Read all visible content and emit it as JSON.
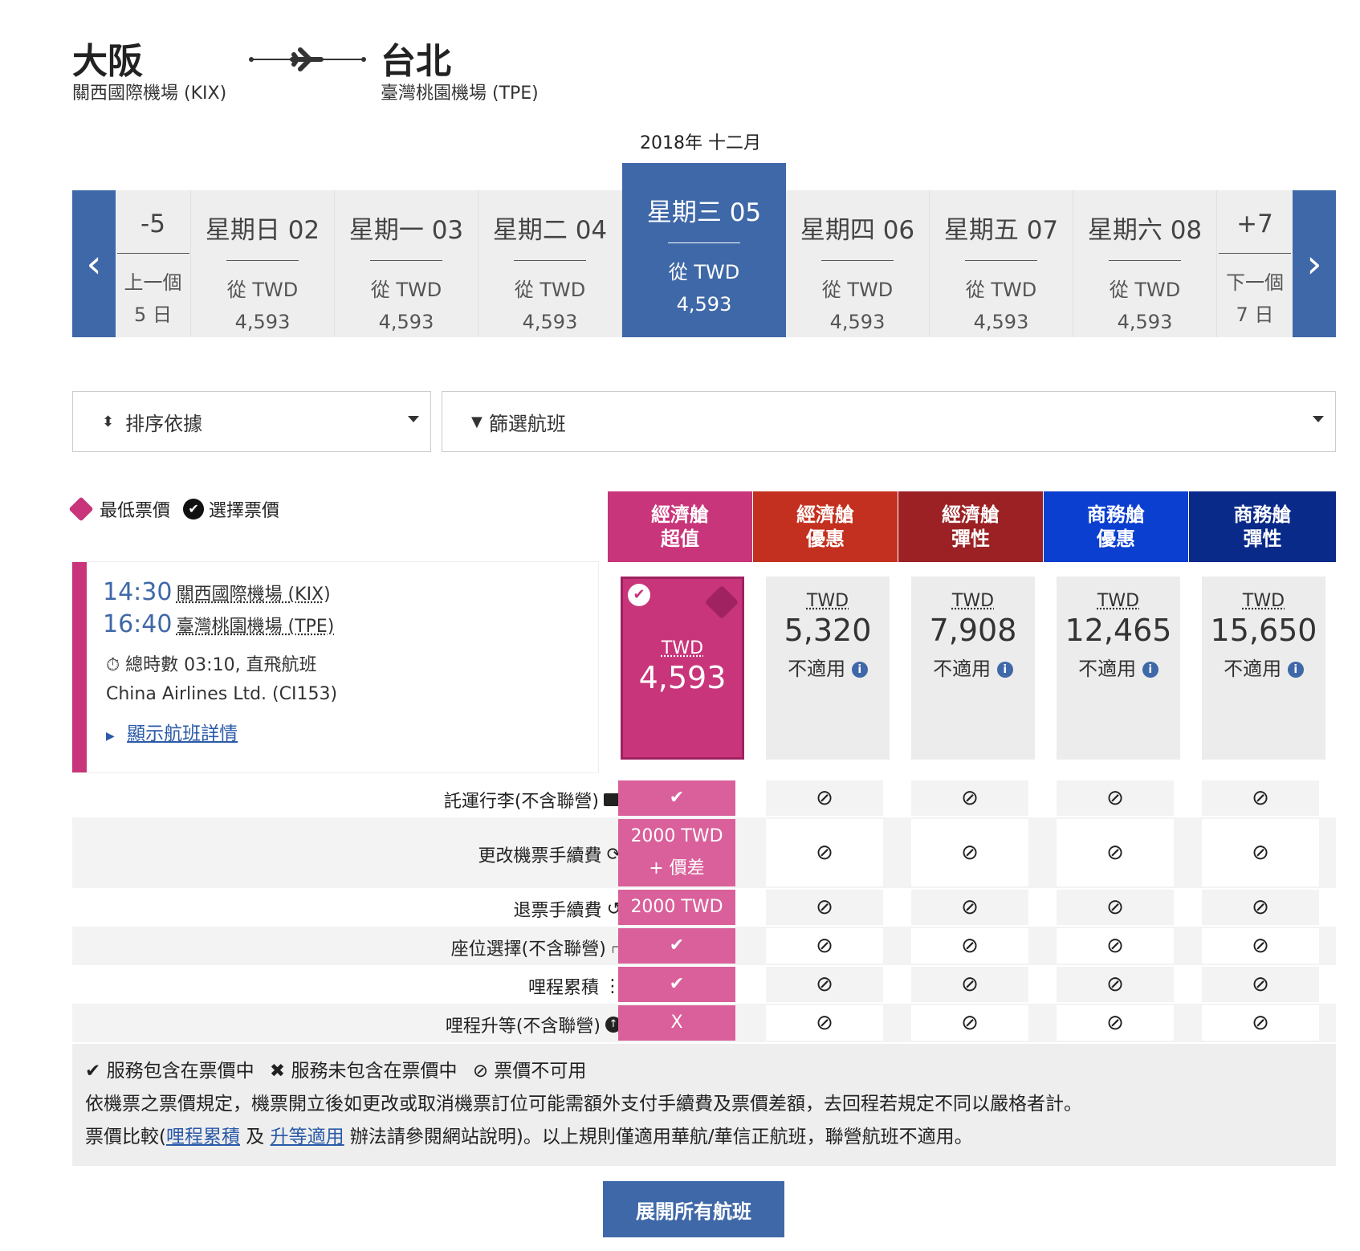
{
  "route": {
    "origin_city": "大阪",
    "origin_airport": "關西國際機場 (KIX)",
    "dest_city": "台北",
    "dest_airport": "臺灣桃園機場 (TPE)"
  },
  "calendar": {
    "month": "2018年 十二月",
    "prev": {
      "day": "-5",
      "label": "上一個",
      "sub": "5 日"
    },
    "next": {
      "day": "+7",
      "label": "下一個",
      "sub": "7 日"
    },
    "days": [
      {
        "day": "星期日 02",
        "from": "從 TWD",
        "price": "4,593"
      },
      {
        "day": "星期一 03",
        "from": "從 TWD",
        "price": "4,593"
      },
      {
        "day": "星期二 04",
        "from": "從 TWD",
        "price": "4,593"
      },
      {
        "day": "星期三 05",
        "from": "從 TWD",
        "price": "4,593"
      },
      {
        "day": "星期四 06",
        "from": "從 TWD",
        "price": "4,593"
      },
      {
        "day": "星期五 07",
        "from": "從 TWD",
        "price": "4,593"
      },
      {
        "day": "星期六 08",
        "from": "從 TWD",
        "price": "4,593"
      }
    ]
  },
  "controls": {
    "sort_label": "排序依據",
    "filter_label": "篩選航班"
  },
  "legend": {
    "lowest": "最低票價",
    "selected": "選擇票價"
  },
  "fare_classes": [
    {
      "line1": "經濟艙",
      "line2": "超值",
      "color": "#c8357a"
    },
    {
      "line1": "經濟艙",
      "line2": "優惠",
      "color": "#c4301f"
    },
    {
      "line1": "經濟艙",
      "line2": "彈性",
      "color": "#9b2124"
    },
    {
      "line1": "商務艙",
      "line2": "優惠",
      "color": "#0a3fd0"
    },
    {
      "line1": "商務艙",
      "line2": "彈性",
      "color": "#0a2a8a"
    }
  ],
  "flight": {
    "dep_time": "14:30",
    "dep_airport": "關西國際機場 (KIX)",
    "arr_time": "16:40",
    "arr_airport": "臺灣桃園機場 (TPE)",
    "duration": "總時數 03:10, 直飛航班",
    "carrier": "China Airlines Ltd. (CI153)",
    "details_link": "顯示航班詳情"
  },
  "fares": [
    {
      "currency": "TWD",
      "amount": "4,593",
      "status": ""
    },
    {
      "currency": "TWD",
      "amount": "5,320",
      "status": "不適用"
    },
    {
      "currency": "TWD",
      "amount": "7,908",
      "status": "不適用"
    },
    {
      "currency": "TWD",
      "amount": "12,465",
      "status": "不適用"
    },
    {
      "currency": "TWD",
      "amount": "15,650",
      "status": "不適用"
    }
  ],
  "benefits": [
    {
      "label": "託運行李(不含聯營)",
      "icon": "briefcase-icon",
      "value": "✔"
    },
    {
      "label": "更改機票手續費",
      "icon": "refresh-icon",
      "value": "2000 TWD + 價差"
    },
    {
      "label": "退票手續費",
      "icon": "refund-icon",
      "value": "2000 TWD"
    },
    {
      "label": "座位選擇(不含聯營)",
      "icon": "seat-icon",
      "value": "✔"
    },
    {
      "label": "哩程累積",
      "icon": "miles-icon",
      "value": "✔"
    },
    {
      "label": "哩程升等(不含聯營)",
      "icon": "upgrade-icon",
      "value": "X"
    }
  ],
  "unavailable_symbol": "⊘",
  "footer": {
    "legend_included": "服務包含在票價中",
    "legend_excluded": "服務未包含在票價中",
    "legend_unavailable": "票價不可用",
    "note1": "依機票之票價規定，機票開立後如更改或取消機票訂位可能需額外支付手續費及票價差額，去回程若規定不同以嚴格者計。",
    "note2_prefix": "票價比較(",
    "link_miles": "哩程累積",
    "note2_and": " 及 ",
    "link_upgrade": "升等適用",
    "note2_suffix": " 辦法請參閱網站說明)。以上規則僅適用華航/華信正航班，聯營航班不適用。"
  },
  "expand_button": "展開所有航班",
  "colors": {
    "brand_blue": "#3f68a8",
    "pink": "#c8357a"
  }
}
